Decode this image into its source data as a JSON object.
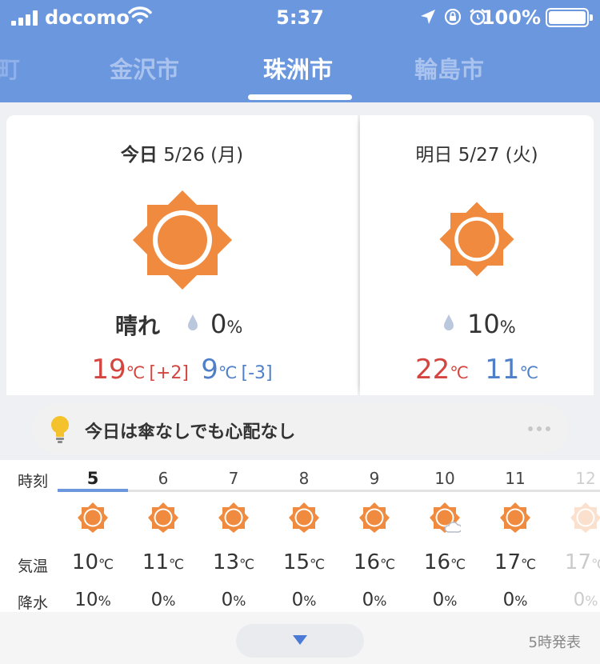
{
  "status_bar": {
    "carrier": "docomo",
    "time": "5:37",
    "battery": "100%"
  },
  "city_tabs": {
    "partial_left": "町",
    "prev": "金沢市",
    "current": "珠洲市",
    "next": "輪島市"
  },
  "today": {
    "label": "今日",
    "date": "5/26",
    "weekday": "(月)",
    "condition": "晴れ",
    "precip_value": "0",
    "precip_unit": "%",
    "high": "19",
    "high_diff": "[+2]",
    "low": "9",
    "low_diff": "[-3]",
    "temp_unit": "℃",
    "icon": "sun-icon"
  },
  "tomorrow": {
    "label": "明日",
    "date": "5/27",
    "weekday": "(火)",
    "precip_value": "10",
    "precip_unit": "%",
    "high": "22",
    "low": "11",
    "temp_unit": "℃",
    "icon": "sun-icon"
  },
  "advice": {
    "text": "今日は傘なしでも心配なし"
  },
  "hourly": {
    "label_time": "時刻",
    "label_temp": "気温",
    "label_rain": "降水",
    "hours": [
      {
        "hour": "5",
        "icon": "sun-icon",
        "temp": "10",
        "rain": "10"
      },
      {
        "hour": "6",
        "icon": "sun-icon",
        "temp": "11",
        "rain": "0"
      },
      {
        "hour": "7",
        "icon": "sun-icon",
        "temp": "13",
        "rain": "0"
      },
      {
        "hour": "8",
        "icon": "sun-icon",
        "temp": "15",
        "rain": "0"
      },
      {
        "hour": "9",
        "icon": "sun-icon",
        "temp": "16",
        "rain": "0"
      },
      {
        "hour": "10",
        "icon": "sun-cloud-icon",
        "temp": "16",
        "rain": "0"
      },
      {
        "hour": "11",
        "icon": "sun-icon",
        "temp": "17",
        "rain": "0"
      },
      {
        "hour": "12",
        "icon": "sun-icon",
        "temp": "17",
        "rain": "0"
      }
    ],
    "temp_unit": "℃",
    "rain_unit": "%"
  },
  "footer": {
    "issued": "5時発表"
  },
  "colors": {
    "header_blue": "#6b97df",
    "sun_orange": "#f08a3e",
    "high_red": "#d4453f",
    "low_blue": "#4f7fc8"
  }
}
